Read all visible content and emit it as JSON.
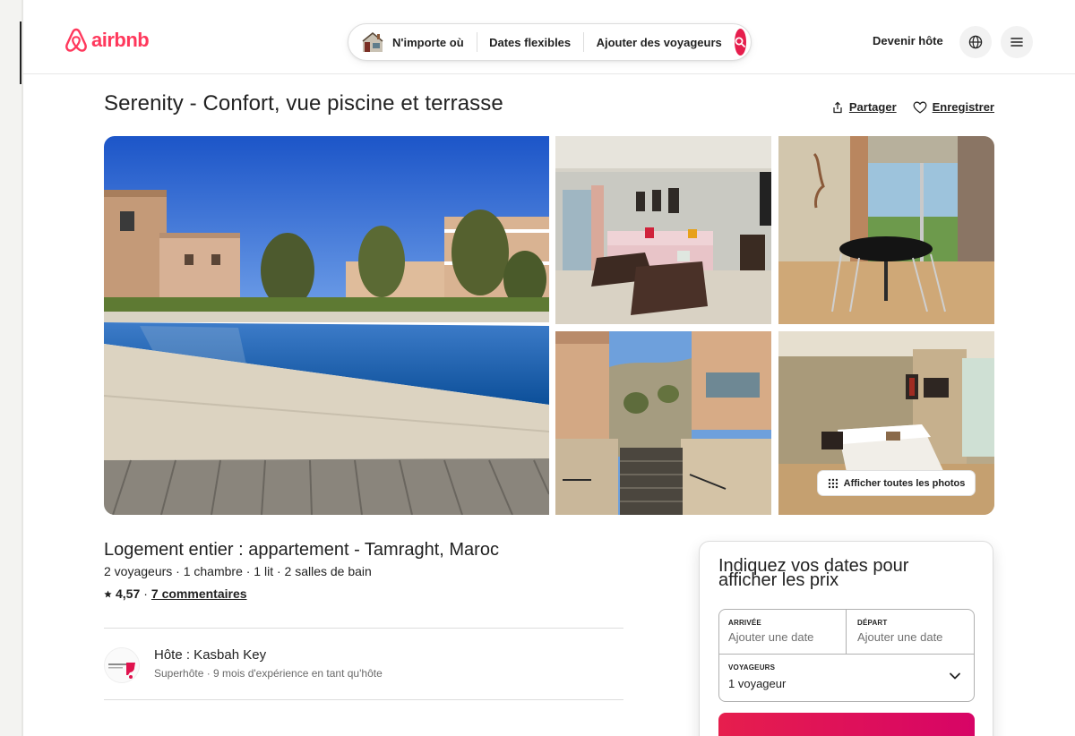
{
  "header": {
    "logo_text": "airbnb",
    "search": {
      "where_label": "N'importe où",
      "dates_label": "Dates flexibles",
      "guests_label": "Ajouter des voyageurs"
    },
    "host_link": "Devenir hôte"
  },
  "listing": {
    "title": "Serenity - Confort, vue piscine et terrasse",
    "share_label": "Partager",
    "save_label": "Enregistrer",
    "show_all_photos_label": "Afficher toutes les photos",
    "subtitle": "Logement entier : appartement - Tamraght, Maroc",
    "details": "2 voyageurs · 1 chambre · 1 lit · 2 salles de bain",
    "rating": "4,57",
    "rating_separator": "·",
    "reviews_link": "7 commentaires",
    "host_name": "Hôte : Kasbah Key",
    "host_meta": "Superhôte · 9 mois d'expérience en tant qu'hôte"
  },
  "booking": {
    "title": "Indiquez vos dates pour afficher les prix",
    "checkin_label": "ARRIVÉE",
    "checkin_placeholder": "Ajouter une date",
    "checkout_label": "DÉPART",
    "checkout_placeholder": "Ajouter une date",
    "guests_label": "VOYAGEURS",
    "guests_value": "1 voyageur"
  },
  "colors": {
    "brand": "#ff385c",
    "search_button": "#e61e4d"
  },
  "icons": {
    "logo": "airbnb-logo-icon",
    "search": "search-icon",
    "globe": "globe-icon",
    "menu": "menu-icon",
    "share": "share-icon",
    "save": "heart-icon",
    "grid": "grid-icon",
    "chevron": "chevron-down-icon",
    "star": "star-icon"
  }
}
